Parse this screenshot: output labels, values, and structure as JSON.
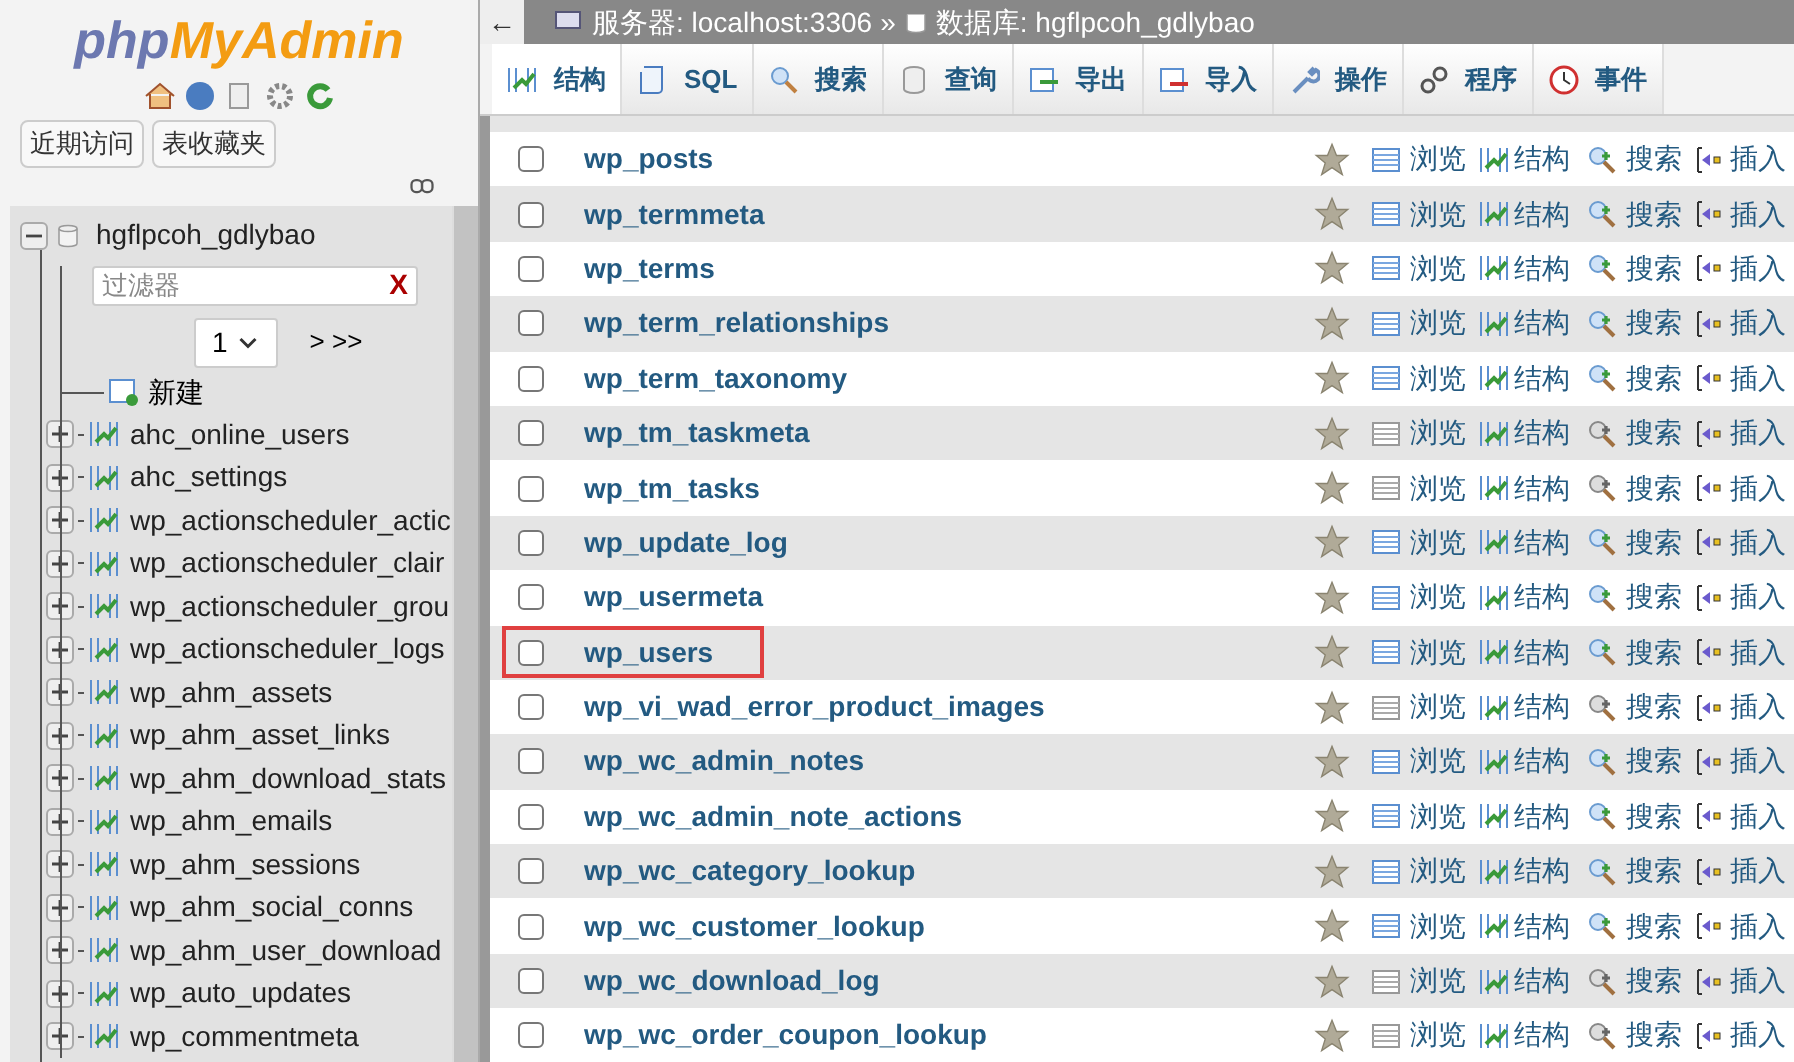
{
  "logo": {
    "part1": "php",
    "part2": "MyAdmin"
  },
  "quick_buttons": [
    "近期访问",
    "表收藏夹"
  ],
  "tree": {
    "database": "hgflpcoh_gdlybao",
    "expanded": true,
    "filter_placeholder": "过滤器",
    "filter_clear": "X",
    "page": "1",
    "page_nav": "> >>",
    "new_item": "新建",
    "tables": [
      "ahc_online_users",
      "ahc_settings",
      "wp_actionscheduler_actic",
      "wp_actionscheduler_clair",
      "wp_actionscheduler_grou",
      "wp_actionscheduler_logs",
      "wp_ahm_assets",
      "wp_ahm_asset_links",
      "wp_ahm_download_stats",
      "wp_ahm_emails",
      "wp_ahm_sessions",
      "wp_ahm_social_conns",
      "wp_ahm_user_download",
      "wp_auto_updates",
      "wp_commentmeta"
    ]
  },
  "breadcrumb": {
    "back": "←",
    "server": "服务器: localhost:3306",
    "separator": "»",
    "database": "数据库: hgflpcoh_gdlybao"
  },
  "tabs": [
    {
      "label": "结构",
      "kind": "structure",
      "selected": true
    },
    {
      "label": "SQL",
      "kind": "sql",
      "selected": false
    },
    {
      "label": "搜索",
      "kind": "search",
      "selected": false
    },
    {
      "label": "查询",
      "kind": "query",
      "selected": false
    },
    {
      "label": "导出",
      "kind": "export",
      "selected": false
    },
    {
      "label": "导入",
      "kind": "import",
      "selected": false
    },
    {
      "label": "操作",
      "kind": "operations",
      "selected": false
    },
    {
      "label": "程序",
      "kind": "routines",
      "selected": false
    },
    {
      "label": "事件",
      "kind": "events",
      "selected": false
    }
  ],
  "rows": [
    {
      "name": "wp_posts",
      "checked": false,
      "highlighted": false,
      "empty": false,
      "actions": [
        "浏览",
        "结构",
        "搜索",
        "插入"
      ]
    },
    {
      "name": "wp_termmeta",
      "checked": false,
      "highlighted": false,
      "empty": false,
      "actions": [
        "浏览",
        "结构",
        "搜索",
        "插入"
      ]
    },
    {
      "name": "wp_terms",
      "checked": false,
      "highlighted": false,
      "empty": false,
      "actions": [
        "浏览",
        "结构",
        "搜索",
        "插入"
      ]
    },
    {
      "name": "wp_term_relationships",
      "checked": false,
      "highlighted": false,
      "empty": false,
      "actions": [
        "浏览",
        "结构",
        "搜索",
        "插入"
      ]
    },
    {
      "name": "wp_term_taxonomy",
      "checked": false,
      "highlighted": false,
      "empty": false,
      "actions": [
        "浏览",
        "结构",
        "搜索",
        "插入"
      ]
    },
    {
      "name": "wp_tm_taskmeta",
      "checked": false,
      "highlighted": false,
      "empty": true,
      "actions": [
        "浏览",
        "结构",
        "搜索",
        "插入"
      ]
    },
    {
      "name": "wp_tm_tasks",
      "checked": false,
      "highlighted": false,
      "empty": true,
      "actions": [
        "浏览",
        "结构",
        "搜索",
        "插入"
      ]
    },
    {
      "name": "wp_update_log",
      "checked": false,
      "highlighted": false,
      "empty": false,
      "actions": [
        "浏览",
        "结构",
        "搜索",
        "插入"
      ]
    },
    {
      "name": "wp_usermeta",
      "checked": false,
      "highlighted": false,
      "empty": false,
      "actions": [
        "浏览",
        "结构",
        "搜索",
        "插入"
      ]
    },
    {
      "name": "wp_users",
      "checked": false,
      "highlighted": true,
      "empty": false,
      "actions": [
        "浏览",
        "结构",
        "搜索",
        "插入"
      ]
    },
    {
      "name": "wp_vi_wad_error_product_images",
      "checked": false,
      "highlighted": false,
      "empty": true,
      "actions": [
        "浏览",
        "结构",
        "搜索",
        "插入"
      ]
    },
    {
      "name": "wp_wc_admin_notes",
      "checked": false,
      "highlighted": false,
      "empty": false,
      "actions": [
        "浏览",
        "结构",
        "搜索",
        "插入"
      ]
    },
    {
      "name": "wp_wc_admin_note_actions",
      "checked": false,
      "highlighted": false,
      "empty": false,
      "actions": [
        "浏览",
        "结构",
        "搜索",
        "插入"
      ]
    },
    {
      "name": "wp_wc_category_lookup",
      "checked": false,
      "highlighted": false,
      "empty": false,
      "actions": [
        "浏览",
        "结构",
        "搜索",
        "插入"
      ]
    },
    {
      "name": "wp_wc_customer_lookup",
      "checked": false,
      "highlighted": false,
      "empty": false,
      "actions": [
        "浏览",
        "结构",
        "搜索",
        "插入"
      ]
    },
    {
      "name": "wp_wc_download_log",
      "checked": false,
      "highlighted": false,
      "empty": true,
      "actions": [
        "浏览",
        "结构",
        "搜索",
        "插入"
      ]
    },
    {
      "name": "wp_wc_order_coupon_lookup",
      "checked": false,
      "highlighted": false,
      "empty": true,
      "actions": [
        "浏览",
        "结构",
        "搜索",
        "插入"
      ]
    }
  ]
}
